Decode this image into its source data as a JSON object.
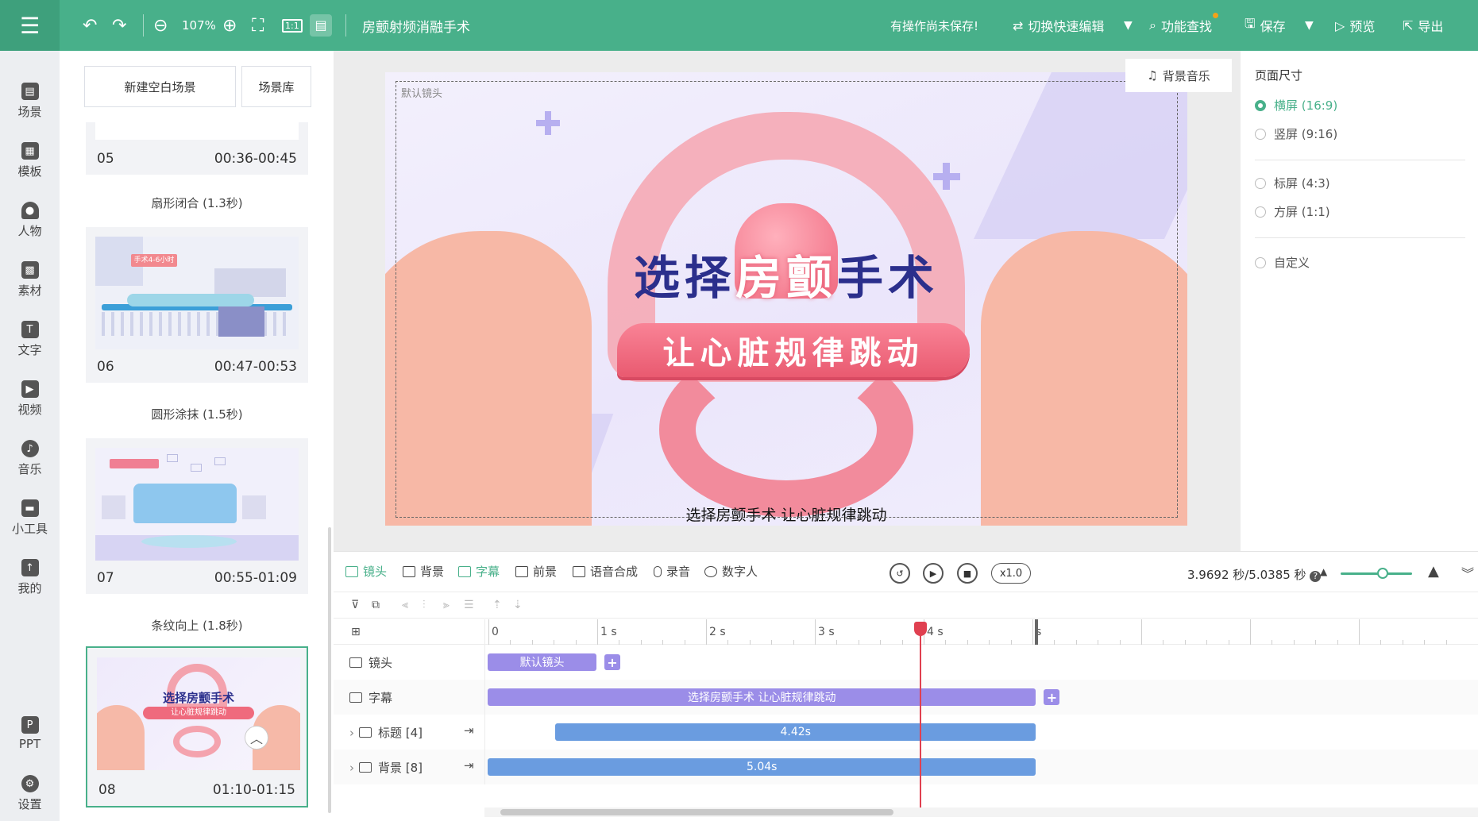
{
  "topbar": {
    "zoom": "107%",
    "title": "房颤射频消融手术",
    "unsaved_notice": "有操作尚未保存!",
    "switch_edit": "切换快速编辑",
    "find": "功能查找",
    "save": "保存",
    "preview": "预览",
    "export": "导出"
  },
  "sidenav": {
    "items": [
      {
        "label": "场景",
        "icon": "scene-icon"
      },
      {
        "label": "模板",
        "icon": "template-icon"
      },
      {
        "label": "人物",
        "icon": "person-icon"
      },
      {
        "label": "素材",
        "icon": "material-icon"
      },
      {
        "label": "文字",
        "icon": "text-icon"
      },
      {
        "label": "视频",
        "icon": "video-icon"
      },
      {
        "label": "音乐",
        "icon": "music-icon"
      },
      {
        "label": "小工具",
        "icon": "toolbox-icon"
      },
      {
        "label": "我的",
        "icon": "upload-icon"
      },
      {
        "label": "PPT",
        "icon": "ppt-icon"
      },
      {
        "label": "设置",
        "icon": "gear-icon"
      }
    ]
  },
  "scenes": {
    "new_blank": "新建空白场景",
    "library": "场景库",
    "items": [
      {
        "num": "05",
        "time": "00:36-00:45",
        "transition": "扇形闭合 (1.3秒)"
      },
      {
        "num": "06",
        "time": "00:47-00:53",
        "transition": "圆形涂抹 (1.5秒)",
        "tag": "手术4-6小时"
      },
      {
        "num": "07",
        "time": "00:55-01:09",
        "transition": "条纹向上 (1.8秒)"
      },
      {
        "num": "08",
        "time": "01:10-01:15",
        "thumb_title": "选择房颤手术",
        "thumb_sub": "让心脏规律跳动"
      }
    ]
  },
  "canvas": {
    "camera_label": "默认镜头",
    "bg_music": "背景音乐",
    "headline_part1": "选择",
    "headline_part2": "房颤",
    "headline_part3": "手术",
    "ribbon_text": "让心脏规律跳动",
    "subtitle": "选择房颤手术  让心脏规律跳动"
  },
  "right_panel": {
    "title": "页面尺寸",
    "options": [
      {
        "label": "横屏",
        "ratio": "(16:9)",
        "selected": true
      },
      {
        "label": "竖屏",
        "ratio": "(9:16)",
        "selected": false
      },
      {
        "label": "标屏",
        "ratio": "(4:3)",
        "selected": false
      },
      {
        "label": "方屏",
        "ratio": "(1:1)",
        "selected": false
      },
      {
        "label": "自定义",
        "ratio": "",
        "selected": false
      }
    ]
  },
  "timeline": {
    "tools": [
      "镜头",
      "背景",
      "字幕",
      "前景",
      "语音合成",
      "录音",
      "数字人"
    ],
    "speed": "x1.0",
    "time_display": "3.9692 秒/5.0385 秒",
    "ruler": [
      "0",
      "1 s",
      "2 s",
      "3 s",
      "4 s",
      "s"
    ],
    "playhead_seconds": 3.9692,
    "zoom_level": 0.42,
    "tracks": [
      {
        "label": "镜头",
        "clip": "默认镜头",
        "start": 0,
        "end": 1.0
      },
      {
        "label": "字幕",
        "clip": "选择房颤手术  让心脏规律跳动",
        "start": 0,
        "end": 5.04
      },
      {
        "label": "标题 [4]",
        "clip": "4.42s",
        "start": 0.62,
        "end": 5.04
      },
      {
        "label": "背景 [8]",
        "clip": "5.04s",
        "start": 0,
        "end": 5.04
      }
    ]
  },
  "colors": {
    "accent": "#48b08a",
    "headline_navy": "#2b2f8c",
    "heart_pink": "#f07f93",
    "clip_purple": "#9b8de8",
    "clip_blue": "#6a9ce0",
    "playhead": "#e04050"
  }
}
